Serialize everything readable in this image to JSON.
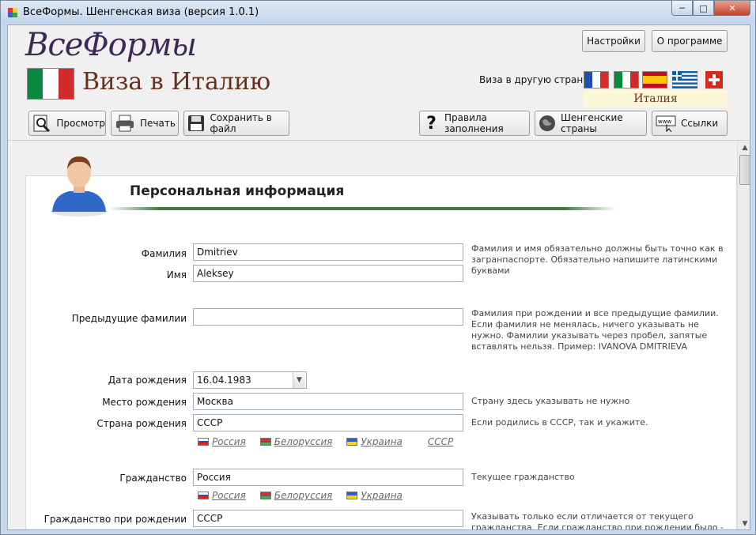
{
  "window": {
    "title": "ВсеФормы. Шенгенская виза (версия 1.0.1)",
    "minimize": "─",
    "maximize": "□",
    "close": "✕"
  },
  "header": {
    "logo": "ВсеФормы",
    "visa_title": "Виза в Италию",
    "settings_label": "Настройки",
    "about_label": "О программе",
    "other_visa_label": "Виза в другую страну:",
    "selected_country": "Италия",
    "country_flags": [
      "france-flag",
      "italy-flag",
      "spain-flag",
      "greece-flag",
      "switzerland-flag"
    ]
  },
  "toolbar": {
    "preview": "Просмотр",
    "print": "Печать",
    "save": "Сохранить в файл",
    "rules": "Правила заполнения",
    "schengen": "Шенгенские страны",
    "links": "Ссылки"
  },
  "section": {
    "title": "Персональная информация"
  },
  "form": {
    "surname": {
      "label": "Фамилия",
      "value": "Dmitriev"
    },
    "name": {
      "label": "Имя",
      "value": "Aleksey"
    },
    "name_hint": "Фамилия и имя обязательно должны быть точно как в загранпаспорте. Обязательно напишите латинскими буквами",
    "prev_surnames": {
      "label": "Предыдущие фамилии",
      "value": "",
      "hint": "Фамилия при рождении и все предыдущие фамилии. Если фамилия не менялась, ничего указывать не нужно. Фамилии указывать через пробел, запятые вставлять нельзя. Пример: IVANOVA DMITRIEVA"
    },
    "birth_date": {
      "label": "Дата рождения",
      "value": "16.04.1983"
    },
    "birth_place": {
      "label": "Место рождения",
      "value": "Москва",
      "hint": "Страну здесь указывать не нужно"
    },
    "birth_country": {
      "label": "Страна рождения",
      "value": "СССР",
      "hint": "Если родились в СССР, так и укажите."
    },
    "citizenship": {
      "label": "Гражданство",
      "value": "Россия",
      "hint": "Текущее гражданство"
    },
    "birth_citizenship": {
      "label": "Гражданство при рождении",
      "value": "СССР",
      "hint": "Указывать только если отличается от текущего гражданства. Если гражданство при рождении было - СССР, так и укажите."
    }
  },
  "quick_links": {
    "russia": "Россия",
    "belarus": "Белоруссия",
    "ukraine": "Украина",
    "ussr": "СССР"
  },
  "colors": {
    "titlebar": "#c9d9ec",
    "accent_green": "#3f7a3f",
    "visa_title": "#6a2f1c",
    "logo": "#3a2a55"
  }
}
